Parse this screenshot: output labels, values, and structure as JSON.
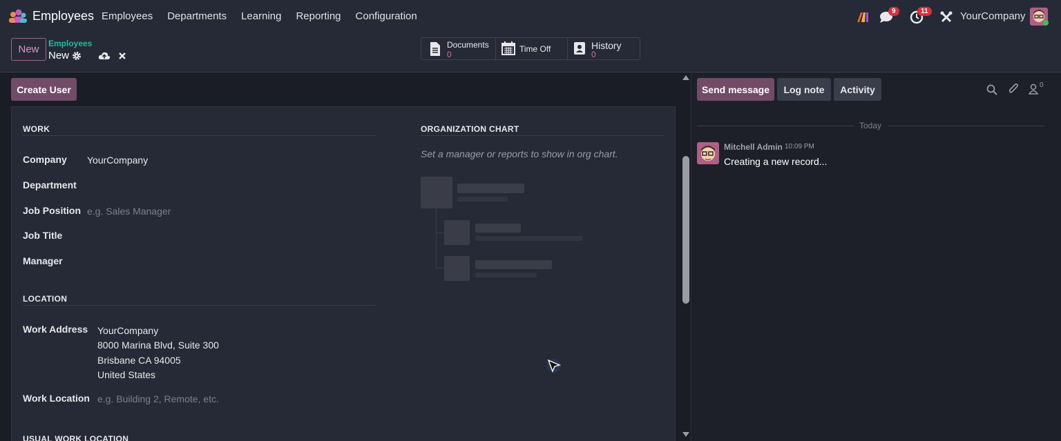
{
  "navbar": {
    "app_name": "Employees",
    "menu": [
      "Employees",
      "Departments",
      "Learning",
      "Reporting",
      "Configuration"
    ],
    "messages_badge": "9",
    "activities_badge": "11",
    "company": "YourCompany",
    "icons": [
      "ai-icon",
      "chat-icon",
      "clock-icon",
      "tools-icon",
      "avatar"
    ]
  },
  "control": {
    "new_label": "New",
    "breadcrumb_parent": "Employees",
    "breadcrumb_current": "New",
    "smart_buttons": [
      {
        "label": "Documents",
        "count": "0"
      },
      {
        "label": "Time Off",
        "count": ""
      },
      {
        "label": "History",
        "count": "0"
      }
    ]
  },
  "form": {
    "create_user_label": "Create User",
    "work": {
      "title": "WORK",
      "company_label": "Company",
      "company_value": "YourCompany",
      "department_label": "Department",
      "job_position_label": "Job Position",
      "job_position_placeholder": "e.g. Sales Manager",
      "job_title_label": "Job Title",
      "manager_label": "Manager"
    },
    "org_chart": {
      "title": "ORGANIZATION CHART",
      "hint": "Set a manager or reports to show in org chart."
    },
    "location": {
      "title": "LOCATION",
      "work_address_label": "Work Address",
      "address_lines": [
        "YourCompany",
        "8000 Marina Blvd, Suite 300",
        "Brisbane CA 94005",
        "United States"
      ],
      "work_location_label": "Work Location",
      "work_location_placeholder": "e.g. Building 2, Remote, etc."
    },
    "usual_location_title": "USUAL WORK LOCATION"
  },
  "chatter": {
    "send_message": "Send message",
    "log_note": "Log note",
    "activity": "Activity",
    "followers_count": "0",
    "today": "Today",
    "message": {
      "author": "Mitchell Admin",
      "time": "10:09 PM",
      "body": "Creating a new record..."
    }
  },
  "colors": {
    "primary": "#714b67",
    "accent_teal": "#27b9a2",
    "badge_red": "#d2333d",
    "count_pink": "#d36ab3"
  }
}
